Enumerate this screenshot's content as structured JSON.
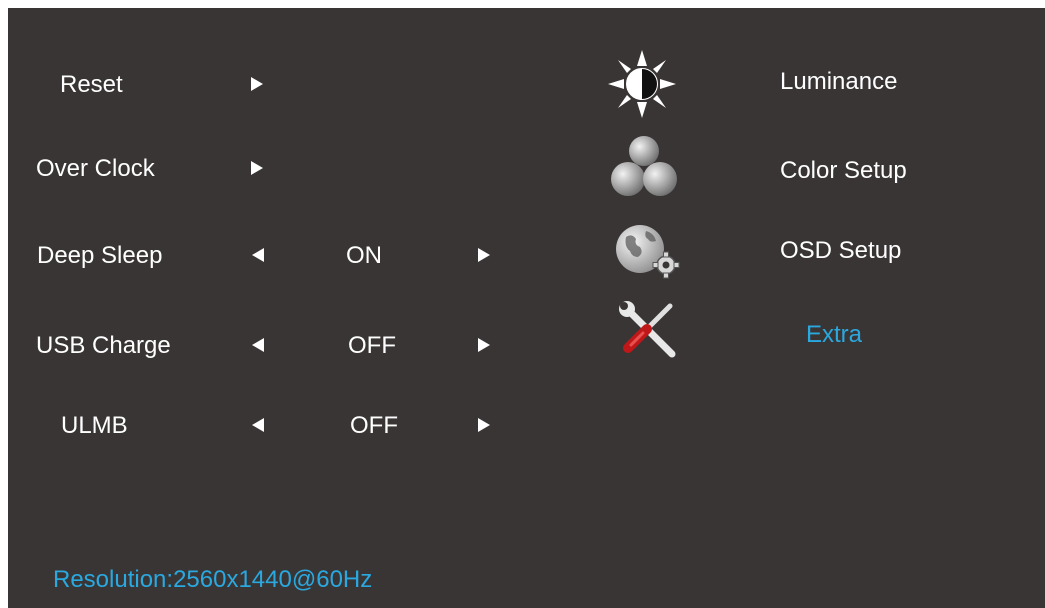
{
  "settings": [
    {
      "label": "Reset"
    },
    {
      "label": "Over Clock"
    },
    {
      "label": "Deep Sleep",
      "value": "ON"
    },
    {
      "label": "USB Charge",
      "value": "OFF"
    },
    {
      "label": "ULMB",
      "value": "OFF"
    }
  ],
  "menu": [
    {
      "label": "Luminance",
      "icon": "luminance-icon"
    },
    {
      "label": "Color Setup",
      "icon": "color-setup-icon"
    },
    {
      "label": "OSD Setup",
      "icon": "osd-setup-icon"
    },
    {
      "label": "Extra",
      "icon": "extra-icon",
      "active": true
    }
  ],
  "footer": {
    "resolution": "Resolution:2560x1440@60Hz"
  },
  "colors": {
    "background": "#3a3535",
    "text": "#ffffff",
    "accent": "#2aa8e0"
  }
}
